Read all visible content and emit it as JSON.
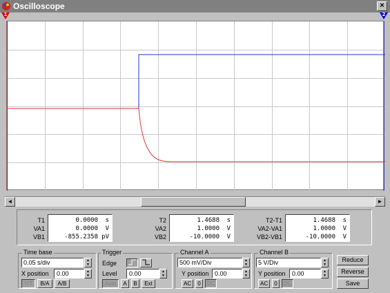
{
  "window": {
    "title": "Oscilloscope",
    "close_label": "×"
  },
  "markers": {
    "t1_label": "1",
    "t2_label": "2"
  },
  "colors": {
    "channel_a": "#e03030",
    "channel_b": "#2030e0",
    "grid": "#c8c8c8",
    "marker_t1": "#e00000",
    "marker_t2": "#0000e0"
  },
  "scrollbar": {
    "left_arrow": "◄",
    "right_arrow": "►"
  },
  "readouts": {
    "left": {
      "labels": [
        "T1",
        "VA1",
        "VB1"
      ],
      "values": [
        "0.0000",
        "0.0000",
        "-855.2358"
      ],
      "units": [
        "s",
        "V",
        "pV"
      ]
    },
    "mid": {
      "labels": [
        "T2",
        "VA2",
        "VB2"
      ],
      "values": [
        "1.4688",
        "1.0000",
        "-10.0000"
      ],
      "units": [
        "s",
        "V",
        "V"
      ]
    },
    "right": {
      "labels": [
        "T2-T1",
        "VA2-VA1",
        "VB2-VB1"
      ],
      "values": [
        "1.4688",
        "1.0000",
        "-10.0000"
      ],
      "units": [
        "s",
        "V",
        "V"
      ]
    }
  },
  "timebase": {
    "title": "Time base",
    "scale": "0.05 s/div",
    "xpos_label": "X position",
    "xpos": "0.00",
    "buttons": [
      "Y/T",
      "B/A",
      "A/B"
    ]
  },
  "trigger": {
    "title": "Trigger",
    "edge_label": "Edge",
    "level_label": "Level",
    "level": "0.00",
    "buttons": [
      "Auto",
      "A",
      "B",
      "Ext"
    ]
  },
  "channel_a": {
    "title": "Channel A",
    "scale": "500 mV/Div",
    "ypos_label": "Y position",
    "ypos": "0.00",
    "buttons": [
      "AC",
      "0",
      "DC"
    ]
  },
  "channel_b": {
    "title": "Channel B",
    "scale": "5  V/Div",
    "ypos_label": "Y position",
    "ypos": "0.00",
    "buttons": [
      "AC",
      "0",
      "DC"
    ]
  },
  "actions": {
    "reduce": "Reduce",
    "reverse": "Reverse",
    "save": "Save"
  }
}
